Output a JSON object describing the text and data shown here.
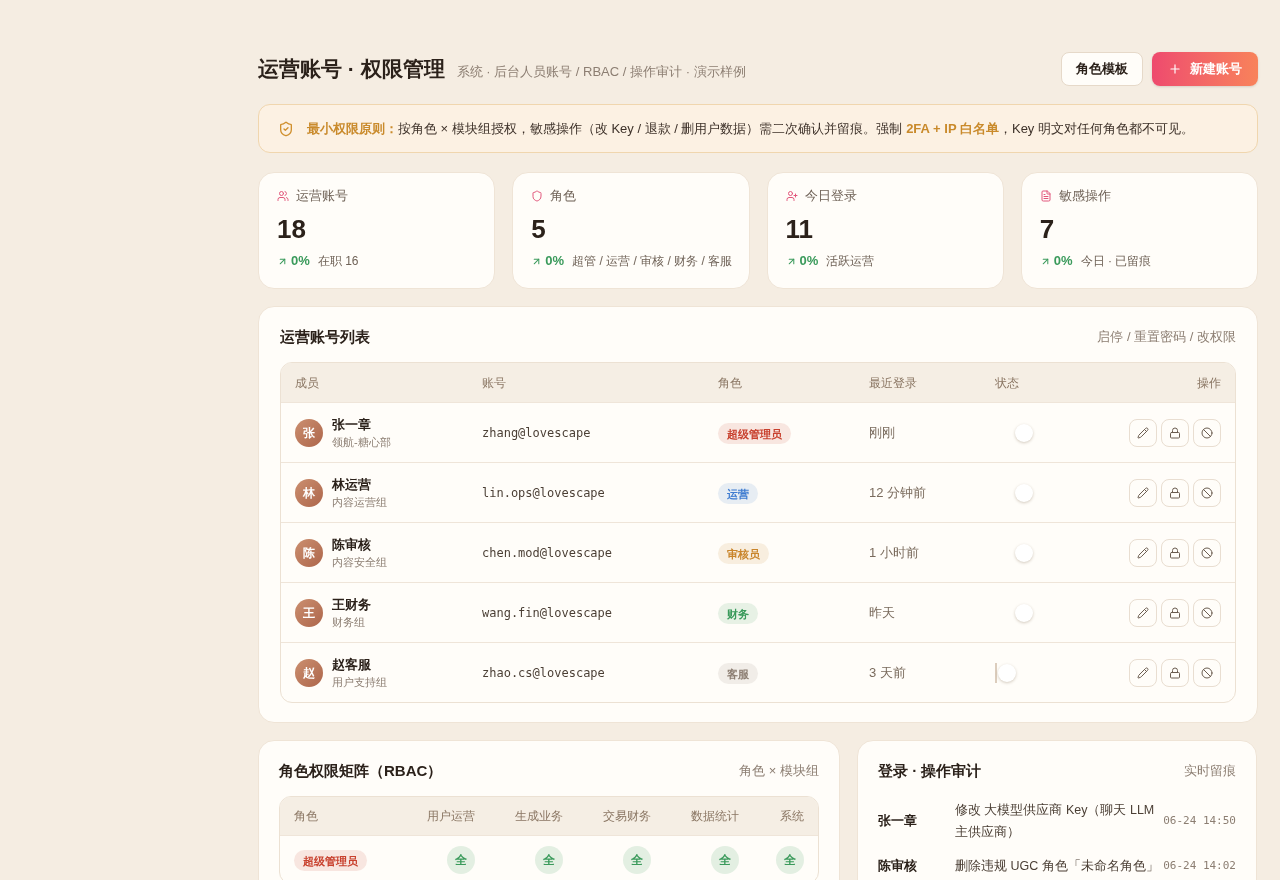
{
  "header": {
    "title": "运营账号 · 权限管理",
    "subtitle": "系统 · 后台人员账号 / RBAC / 操作审计 · 演示样例",
    "buttons": [
      {
        "label": "角色模板",
        "kind": "secondary"
      },
      {
        "label": "新建账号",
        "kind": "primary"
      }
    ]
  },
  "notice": {
    "text": "**最小权限原则：**按角色 × 模块组授权，敏感操作（改 Key / 退款 / 删用户数据）需二次确认并留痕。强制 **2FA + IP 白名单**，Key 明文对任何角色都不可见。"
  },
  "stats": [
    {
      "kind": "users",
      "label": "运营账号",
      "value": "18",
      "change": "0%",
      "note": "在职 16"
    },
    {
      "kind": "shield",
      "label": "角色",
      "value": "5",
      "change": "0%",
      "note": "超管 / 运营 / 审核 / 财务 / 客服"
    },
    {
      "kind": "user-plus",
      "label": "今日登录",
      "value": "11",
      "change": "0%",
      "note": "活跃运营"
    },
    {
      "kind": "log",
      "label": "敏感操作",
      "value": "7",
      "change": "0%",
      "note": "今日 · 已留痕"
    }
  ],
  "accounts": {
    "title": "运营账号列表",
    "hint": "启停 / 重置密码 / 改权限",
    "columns": [
      "成员",
      "账号",
      "角色",
      "最近登录",
      "状态",
      "操作"
    ],
    "rows": [
      {
        "avatar": "张",
        "name": "张一章",
        "team": "领航-糖心部",
        "account": "zhang@lovescape",
        "role": {
          "label": "超级管理员",
          "color": "#c8412e"
        },
        "last_login": "刚刚",
        "enabled": true
      },
      {
        "avatar": "林",
        "name": "林运营",
        "team": "内容运营组",
        "account": "lin.ops@lovescape",
        "role": {
          "label": "运营",
          "color": "#3d7bd0"
        },
        "last_login": "12 分钟前",
        "enabled": true
      },
      {
        "avatar": "陈",
        "name": "陈审核",
        "team": "内容安全组",
        "account": "chen.mod@lovescape",
        "role": {
          "label": "审核员",
          "color": "#c9852b"
        },
        "last_login": "1 小时前",
        "enabled": true
      },
      {
        "avatar": "王",
        "name": "王财务",
        "team": "财务组",
        "account": "wang.fin@lovescape",
        "role": {
          "label": "财务",
          "color": "#3a9a5b"
        },
        "last_login": "昨天",
        "enabled": true
      },
      {
        "avatar": "赵",
        "name": "赵客服",
        "team": "用户支持组",
        "account": "zhao.cs@lovescape",
        "role": {
          "label": "客服",
          "color": "#8c7e72"
        },
        "last_login": "3 天前",
        "enabled": false
      }
    ]
  },
  "rbac": {
    "title": "角色权限矩阵（RBAC）",
    "hint": "角色 × 模块组",
    "columns": [
      "角色",
      "用户运营",
      "生成业务",
      "交易财务",
      "数据统计",
      "系统"
    ],
    "rows": [
      {
        "cells": [
          {
            "kind": "role",
            "label": "超级管理员",
            "color": "#c8412e"
          },
          {
            "kind": "access",
            "label": "全",
            "color": "#3a9a5b"
          },
          {
            "kind": "access",
            "label": "全",
            "color": "#3a9a5b"
          },
          {
            "kind": "access",
            "label": "全",
            "color": "#3a9a5b"
          },
          {
            "kind": "access",
            "label": "全",
            "color": "#3a9a5b"
          },
          {
            "kind": "access",
            "label": "全",
            "color": "#3a9a5b"
          }
        ]
      }
    ]
  },
  "audit": {
    "title": "登录 · 操作审计",
    "hint": "实时留痕",
    "entries": [
      {
        "actor": "张一章",
        "action": "修改 大模型供应商 Key（聊天 LLM 主供应商）",
        "time": "06-24 14:50"
      },
      {
        "actor": "陈审核",
        "action": "删除违规 UGC 角色「未命名角色」",
        "time": "06-24 14:02"
      }
    ]
  }
}
